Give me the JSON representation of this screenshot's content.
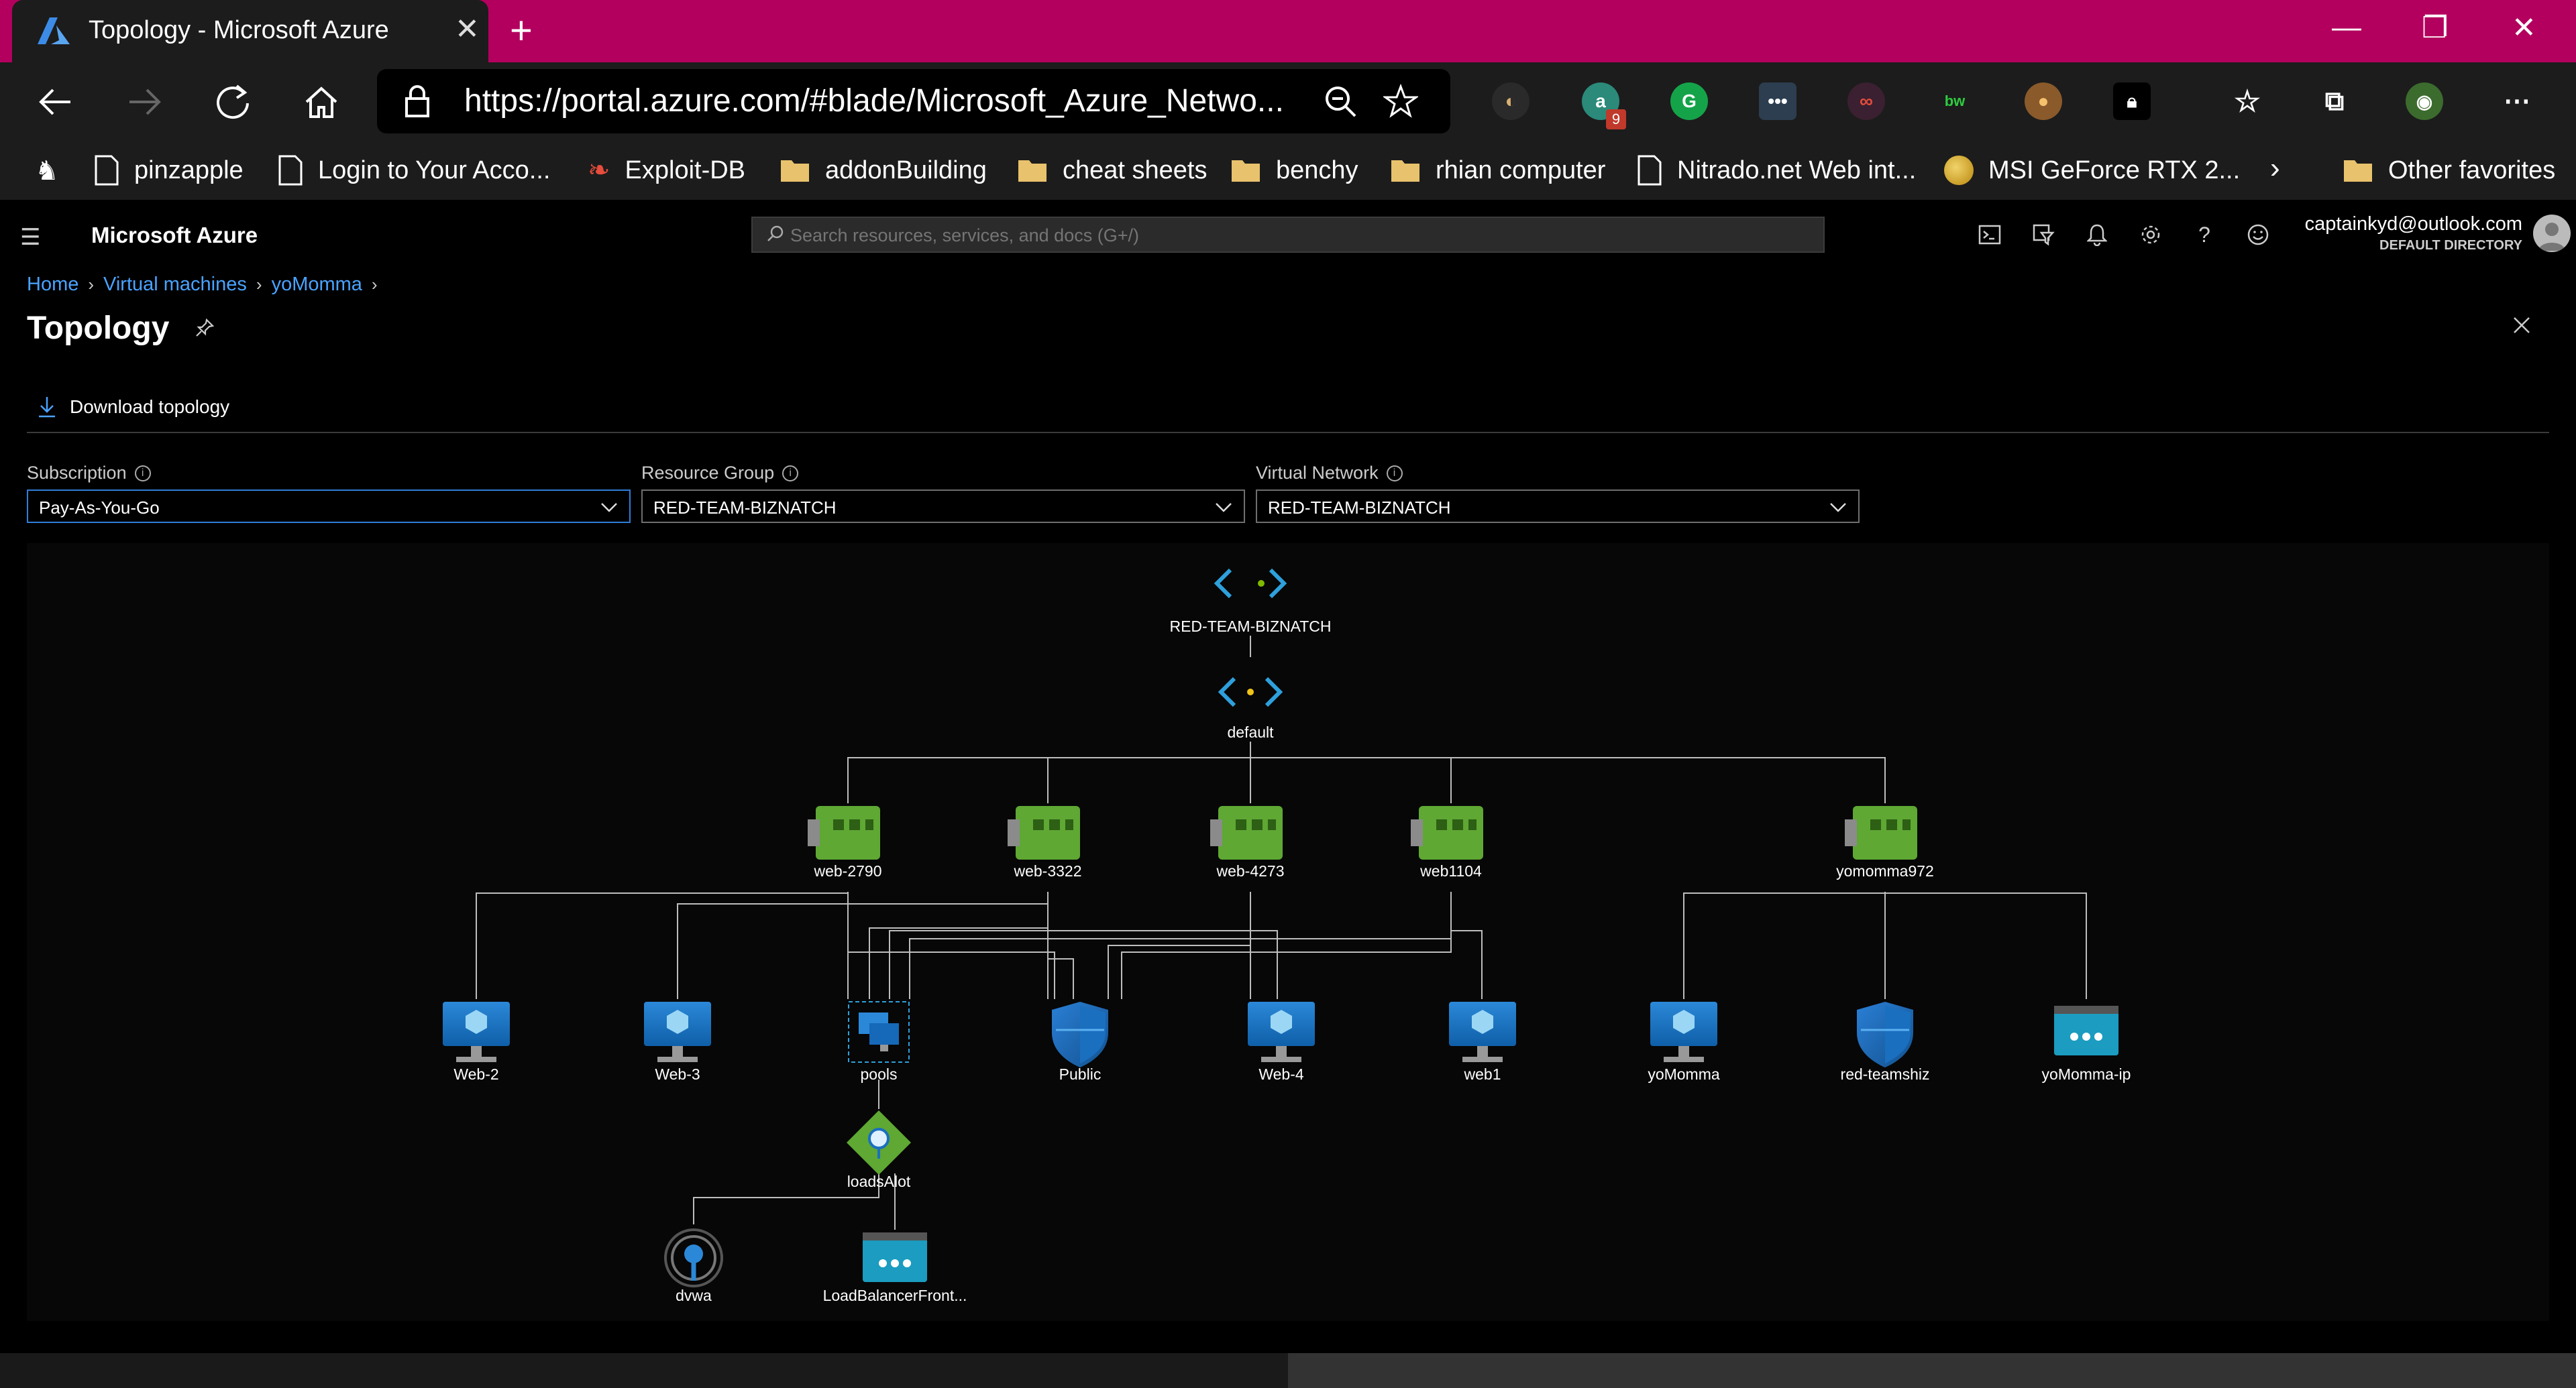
{
  "browser": {
    "tab_title": "Topology - Microsoft Azure",
    "url": "https://portal.azure.com/#blade/Microsoft_Azure_Netwo...",
    "extension_badge": "9",
    "favorites": [
      {
        "label": "pinzapple",
        "icon": "page-icon"
      },
      {
        "label": "Login to Your Acco...",
        "icon": "page-icon"
      },
      {
        "label": "Exploit-DB",
        "icon": "exploitdb-icon"
      },
      {
        "label": "addonBuilding",
        "icon": "folder-icon"
      },
      {
        "label": "cheat sheets",
        "icon": "folder-icon"
      },
      {
        "label": "benchy",
        "icon": "folder-icon"
      },
      {
        "label": "rhian computer",
        "icon": "folder-icon"
      },
      {
        "label": "Nitrado.net Web int...",
        "icon": "page-icon"
      },
      {
        "label": "MSI GeForce RTX 2...",
        "icon": "msi-icon"
      }
    ],
    "other_favorites": "Other favorites"
  },
  "azure": {
    "brand": "Microsoft Azure",
    "search_placeholder": "Search resources, services, and docs (G+/)",
    "account_email": "captainkyd@outlook.com",
    "account_directory": "DEFAULT DIRECTORY"
  },
  "blade": {
    "breadcrumb": [
      "Home",
      "Virtual machines",
      "yoMomma"
    ],
    "title": "Topology",
    "download_label": "Download topology",
    "filters": {
      "subscription_label": "Subscription",
      "subscription_value": "Pay-As-You-Go",
      "resource_group_label": "Resource Group",
      "resource_group_value": "RED-TEAM-BIZNATCH",
      "virtual_network_label": "Virtual Network",
      "virtual_network_value": "RED-TEAM-BIZNATCH"
    }
  },
  "topology": {
    "vnet": "RED-TEAM-BIZNATCH",
    "subnet": "default",
    "nics": [
      "web-2790",
      "web-3322",
      "web-4273",
      "web1104",
      "yomomma972"
    ],
    "resources": [
      {
        "label": "Web-2",
        "type": "vm"
      },
      {
        "label": "Web-3",
        "type": "vm"
      },
      {
        "label": "pools",
        "type": "backend-pool"
      },
      {
        "label": "Public",
        "type": "nsg"
      },
      {
        "label": "Web-4",
        "type": "vm"
      },
      {
        "label": "web1",
        "type": "vm"
      },
      {
        "label": "yoMomma",
        "type": "vm"
      },
      {
        "label": "red-teamshiz",
        "type": "nsg"
      },
      {
        "label": "yoMomma-ip",
        "type": "public-ip"
      }
    ],
    "load_balancer": "loadsAlot",
    "lb_children": [
      {
        "label": "dvwa",
        "type": "probe"
      },
      {
        "label": "LoadBalancerFront...",
        "type": "frontend-ip"
      }
    ]
  }
}
